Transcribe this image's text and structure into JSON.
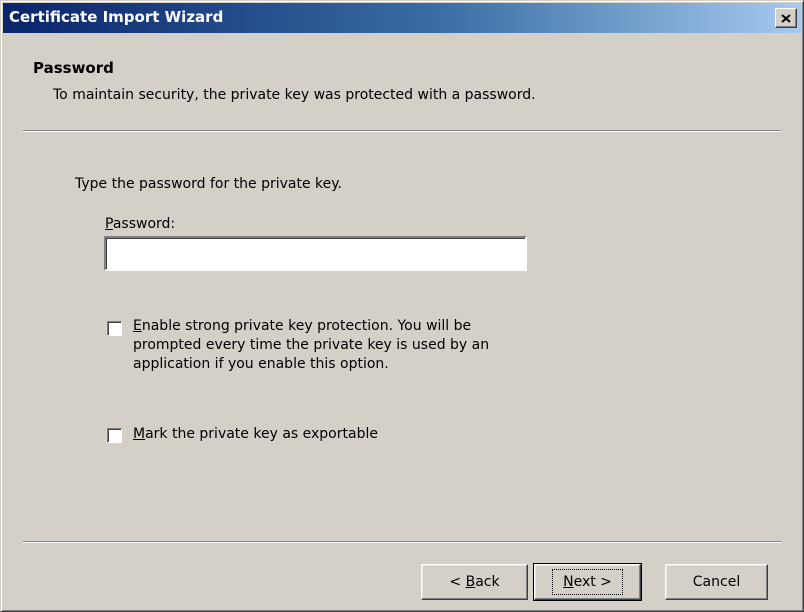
{
  "window": {
    "title": "Certificate Import Wizard",
    "close_label": "×"
  },
  "header": {
    "title": "Password",
    "description": "To maintain security, the private key was protected with a password."
  },
  "body": {
    "instruction": "Type the password for the private key.",
    "password_label": "Password:",
    "password_value": "",
    "strong_protection_label_lines": [
      "Enable strong private key protection. You will be",
      "prompted every time the private key is used by an",
      "application if you enable this option."
    ],
    "strong_protection_checked": false,
    "exportable_label": "Mark the private key as exportable",
    "exportable_checked": false
  },
  "buttons": {
    "back": "< Back",
    "next": "Next >",
    "cancel": "Cancel"
  },
  "colors": {
    "title_bar_start": "#0a246a",
    "title_bar_end": "#a6caf0",
    "dialog_face": "#d4d0c8"
  }
}
